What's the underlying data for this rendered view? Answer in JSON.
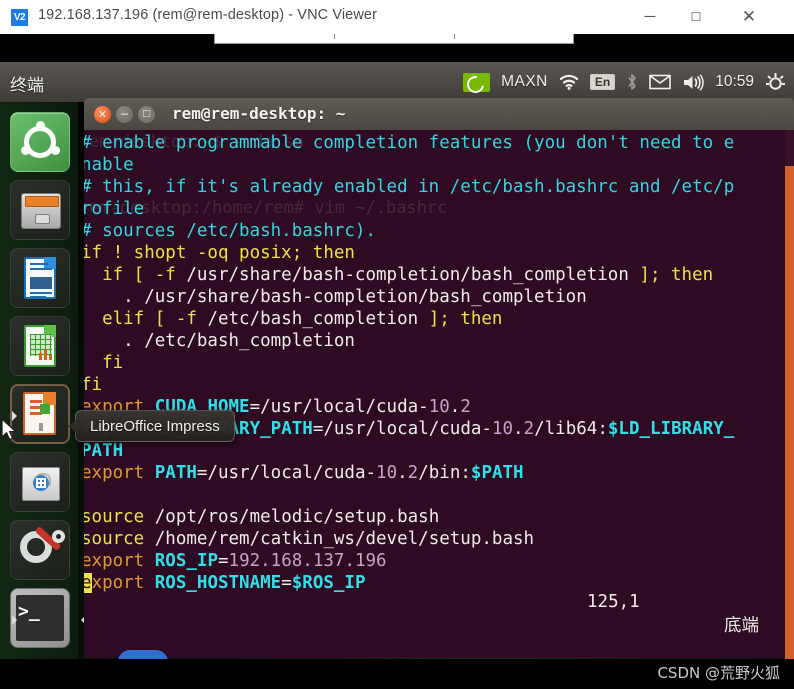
{
  "vnc": {
    "logo": "V2",
    "title": "192.168.137.196 (rem@rem-desktop) - VNC Viewer",
    "minimize": "─",
    "maximize": "☐",
    "close": "✕"
  },
  "ubuntu_panel": {
    "app_name": "终端",
    "tray": {
      "nvidia_label": "MAXN",
      "input_method": "En",
      "clock": "10:59",
      "icons": [
        "nvidia-icon",
        "wifi-icon",
        "input-method-icon",
        "bluetooth-icon",
        "mail-icon",
        "volume-icon",
        "settings-gear-icon"
      ]
    }
  },
  "launcher": {
    "items": [
      {
        "name": "ubuntu-dash",
        "label": "Dash home"
      },
      {
        "name": "files",
        "label": "Files"
      },
      {
        "name": "libreoffice-writer",
        "label": "LibreOffice Writer"
      },
      {
        "name": "libreoffice-calc",
        "label": "LibreOffice Calc"
      },
      {
        "name": "libreoffice-impress",
        "label": "LibreOffice Impress"
      },
      {
        "name": "ubuntu-software",
        "label": "Ubuntu Software"
      },
      {
        "name": "system-settings",
        "label": "System Settings"
      },
      {
        "name": "terminal",
        "label": "Terminal"
      }
    ]
  },
  "tooltip": {
    "text": "LibreOffice Impress"
  },
  "terminal": {
    "title": "rem@rem-desktop: ~",
    "buttons": {
      "close": "✕",
      "minimize": "─",
      "maximize": "□"
    },
    "ghost_lines": [
      "rem@rem-desktop:~$ sudo su",
      "rem@rem-desktop:/home/rem# vim ~/.bashrc"
    ],
    "lines": [
      {
        "segs": [
          {
            "t": "# enable programmable completion features (you don't need to e",
            "c": "c-cyan"
          }
        ]
      },
      {
        "segs": [
          {
            "t": "nable",
            "c": "c-cyan"
          }
        ]
      },
      {
        "segs": [
          {
            "t": "# this, if it's already enabled in /etc/bash.bashrc and /etc/p",
            "c": "c-cyan"
          }
        ]
      },
      {
        "segs": [
          {
            "t": "rofile",
            "c": "c-cyan"
          }
        ]
      },
      {
        "segs": [
          {
            "t": "# sources /etc/bash.bashrc).",
            "c": "c-cyan"
          }
        ]
      },
      {
        "segs": [
          {
            "t": "if ! shopt -oq posix; then",
            "c": "c-yellow"
          }
        ]
      },
      {
        "segs": [
          {
            "t": "  if [ -f ",
            "c": "c-yellow"
          },
          {
            "t": "/usr/share/bash-completion/bash_completion",
            "c": "c-white"
          },
          {
            "t": " ]; then",
            "c": "c-yellow"
          }
        ]
      },
      {
        "segs": [
          {
            "t": "    . ",
            "c": "c-white"
          },
          {
            "t": "/usr/share/bash-completion/bash_completion",
            "c": "c-white"
          }
        ]
      },
      {
        "segs": [
          {
            "t": "  elif [ -f ",
            "c": "c-yellow"
          },
          {
            "t": "/etc/bash_completion",
            "c": "c-white"
          },
          {
            "t": " ]; then",
            "c": "c-yellow"
          }
        ]
      },
      {
        "segs": [
          {
            "t": "    . ",
            "c": "c-white"
          },
          {
            "t": "/etc/bash_completion",
            "c": "c-white"
          }
        ]
      },
      {
        "segs": [
          {
            "t": "  fi",
            "c": "c-yellow"
          }
        ]
      },
      {
        "segs": [
          {
            "t": "fi",
            "c": "c-yellow"
          }
        ]
      },
      {
        "segs": [
          {
            "t": "export ",
            "c": "c-orange"
          },
          {
            "t": "CUDA_HOME",
            "c": "c-bold-cyan"
          },
          {
            "t": "=/usr/local/cuda-",
            "c": "c-white"
          },
          {
            "t": "10",
            "c": "c-num"
          },
          {
            "t": ".",
            "c": "c-white"
          },
          {
            "t": "2",
            "c": "c-num"
          }
        ]
      },
      {
        "segs": [
          {
            "t": "export ",
            "c": "c-orange"
          },
          {
            "t": "LD_LIBRARY_PATH",
            "c": "c-bold-cyan"
          },
          {
            "t": "=/usr/local/cuda-",
            "c": "c-white"
          },
          {
            "t": "10",
            "c": "c-num"
          },
          {
            "t": ".",
            "c": "c-white"
          },
          {
            "t": "2",
            "c": "c-num"
          },
          {
            "t": "/lib64:",
            "c": "c-white"
          },
          {
            "t": "$LD_LIBRARY_",
            "c": "c-bold-cyan"
          }
        ]
      },
      {
        "segs": [
          {
            "t": "PATH",
            "c": "c-bold-cyan"
          }
        ]
      },
      {
        "segs": [
          {
            "t": "export ",
            "c": "c-orange"
          },
          {
            "t": "PATH",
            "c": "c-bold-cyan"
          },
          {
            "t": "=/usr/local/cuda-",
            "c": "c-white"
          },
          {
            "t": "10",
            "c": "c-num"
          },
          {
            "t": ".",
            "c": "c-white"
          },
          {
            "t": "2",
            "c": "c-num"
          },
          {
            "t": "/bin:",
            "c": "c-white"
          },
          {
            "t": "$PATH",
            "c": "c-bold-cyan"
          }
        ]
      },
      {
        "segs": [
          {
            "t": "",
            "c": "c-white"
          }
        ]
      },
      {
        "segs": [
          {
            "t": "source ",
            "c": "c-yellow"
          },
          {
            "t": "/opt/ros/melodic/setup.bash",
            "c": "c-white"
          }
        ]
      },
      {
        "segs": [
          {
            "t": "source ",
            "c": "c-yellow"
          },
          {
            "t": "/home/rem/catkin_ws/devel/setup.bash",
            "c": "c-white"
          }
        ]
      },
      {
        "segs": [
          {
            "t": "export ",
            "c": "c-orange"
          },
          {
            "t": "ROS_IP",
            "c": "c-bold-cyan"
          },
          {
            "t": "=",
            "c": "c-white"
          },
          {
            "t": "192.168.137.196",
            "c": "c-num"
          }
        ]
      },
      {
        "segs": [
          {
            "t": "e",
            "c": "cursor-blk"
          },
          {
            "t": "xport ",
            "c": "c-orange"
          },
          {
            "t": "ROS_HOSTNAME",
            "c": "c-bold-cyan"
          },
          {
            "t": "=",
            "c": "c-white"
          },
          {
            "t": "$ROS_IP",
            "c": "c-bold-cyan"
          }
        ]
      }
    ],
    "status": {
      "position": "125,1",
      "state": "底端"
    }
  },
  "watermark": "CSDN @荒野火狐",
  "colors": {
    "terminal_bg": "#2e0b22",
    "accent_orange": "#d4622a",
    "panel_bg": "#4b4844",
    "nvidia_green": "#76b900"
  }
}
